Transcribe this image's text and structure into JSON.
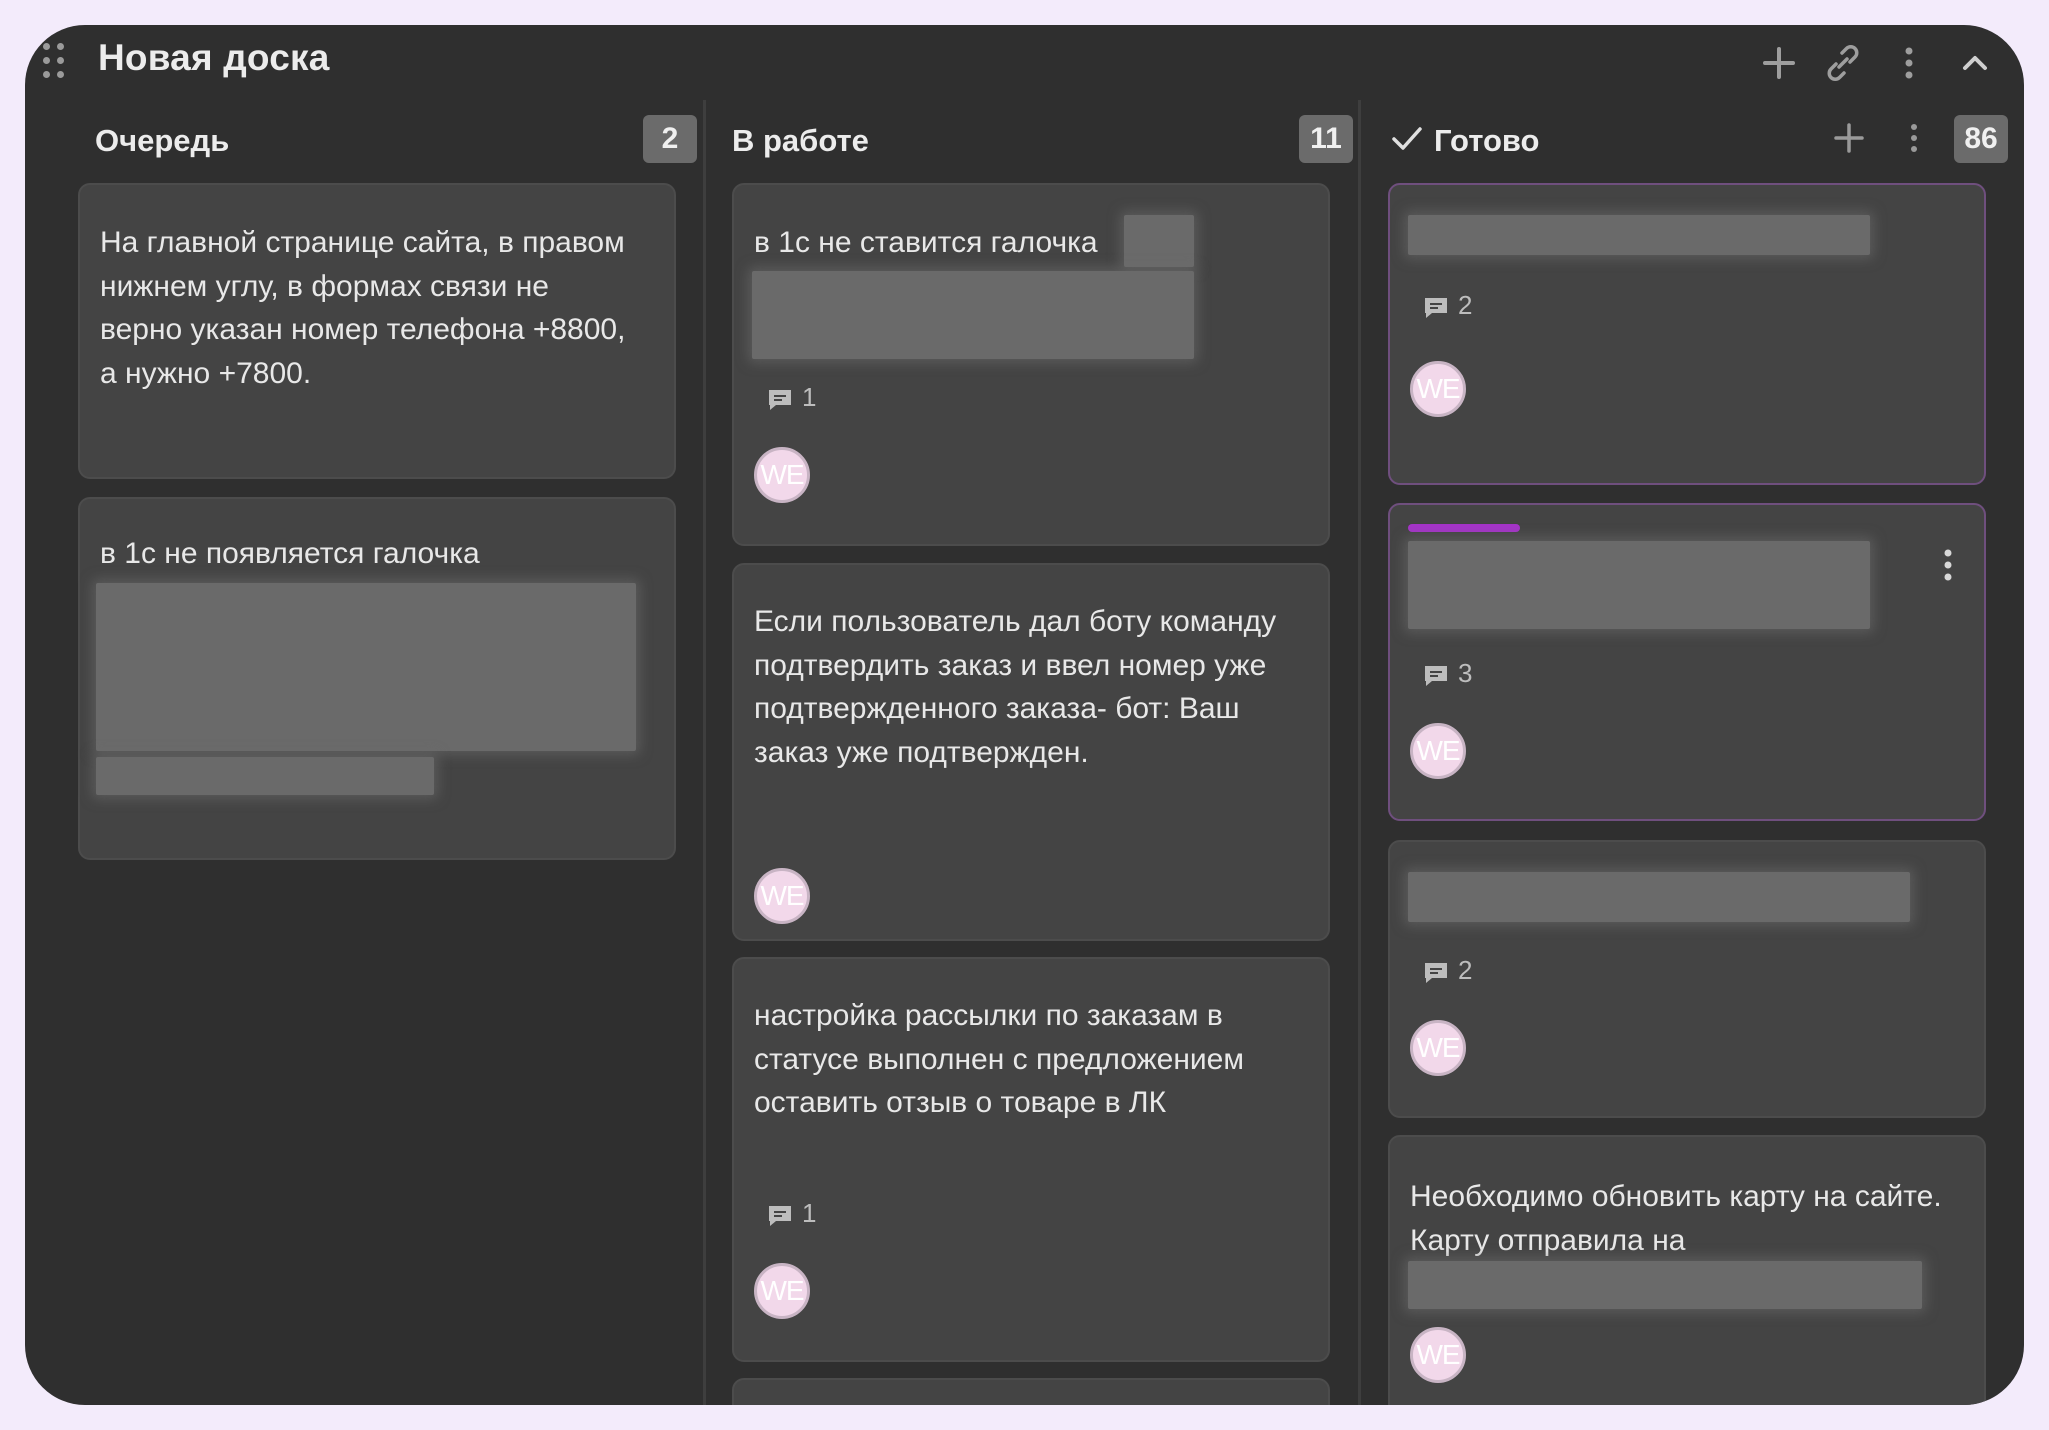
{
  "board": {
    "title": "Новая доска",
    "icons": [
      "drag-handle-icon",
      "plus-icon",
      "link-icon",
      "more-vertical-icon",
      "chevron-up-icon"
    ]
  },
  "columns": [
    {
      "title": "Очередь",
      "count": "2",
      "cards": [
        {
          "text": "На главной странице сайта, в правом нижнем углу, в формах связи не верно указан номер телефона +8800, а нужно +7800."
        },
        {
          "text": "в 1с не появляется галочка",
          "redacted": true
        }
      ]
    },
    {
      "title": "В работе",
      "count": "11",
      "cards": [
        {
          "text": "в 1с не ставится галочка",
          "redacted": true,
          "comments": "1",
          "avatar": "WE"
        },
        {
          "text": "Если пользователь дал боту команду подтвердить заказ и ввел номер уже подтвержденного заказа- бот: Ваш заказ уже подтвержден.",
          "avatar": "WE"
        },
        {
          "text": "настройка рассылки по заказам в статусе выполнен с предложением оставить отзыв о товаре в ЛК",
          "comments": "1",
          "avatar": "WE"
        }
      ]
    },
    {
      "title": "Готово",
      "count": "86",
      "done": true,
      "cards": [
        {
          "redacted": true,
          "comments": "2",
          "avatar": "WE"
        },
        {
          "redacted": true,
          "label_color": "#a534c9",
          "comments": "3",
          "avatar": "WE"
        },
        {
          "redacted": true,
          "comments": "2",
          "avatar": "WE"
        },
        {
          "text": "Необходимо обновить карту на сайте. Карту отправила на",
          "redacted": true,
          "avatar": "WE"
        }
      ]
    }
  ],
  "colors": {
    "background": "#2f2f2f",
    "card": "#444444",
    "count_badge": "#6b6b6b",
    "accent_purple": "#a534c9",
    "frame": "#f3ebfb"
  }
}
